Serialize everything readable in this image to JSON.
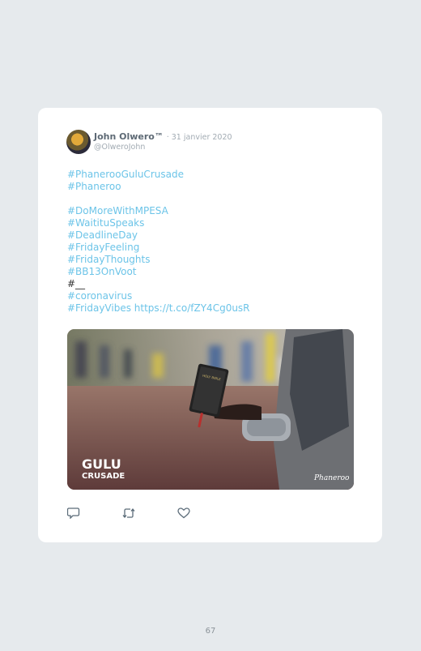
{
  "tweet": {
    "author_name": "John Olwero™",
    "date": "· 31 janvier 2020",
    "handle": "@OlweroJohn",
    "lines": [
      "#PhanerooGuluCrusade",
      "#Phaneroo",
      "",
      "#DoMoreWithMPESA",
      "#WaitituSpeaks",
      "#DeadlineDay",
      "#FridayFeeling",
      "#FridayThoughts",
      "#BB13OnVoot",
      "#__",
      "#coronavirus",
      "#FridayVibes https://t.co/fZY4Cg0usR"
    ],
    "image": {
      "overlay_title_1": "GULU",
      "overlay_title_2": "CRUSADE",
      "book_text": "HOLY BIBLE",
      "logo_text": "Phaneroo"
    },
    "actions": {
      "reply": "reply-icon",
      "retweet": "retweet-icon",
      "like": "heart-icon"
    }
  },
  "page": {
    "number": "67"
  },
  "colors": {
    "link": "#6cc4e8",
    "card": "#ffffff",
    "background": "#e6eaed"
  }
}
